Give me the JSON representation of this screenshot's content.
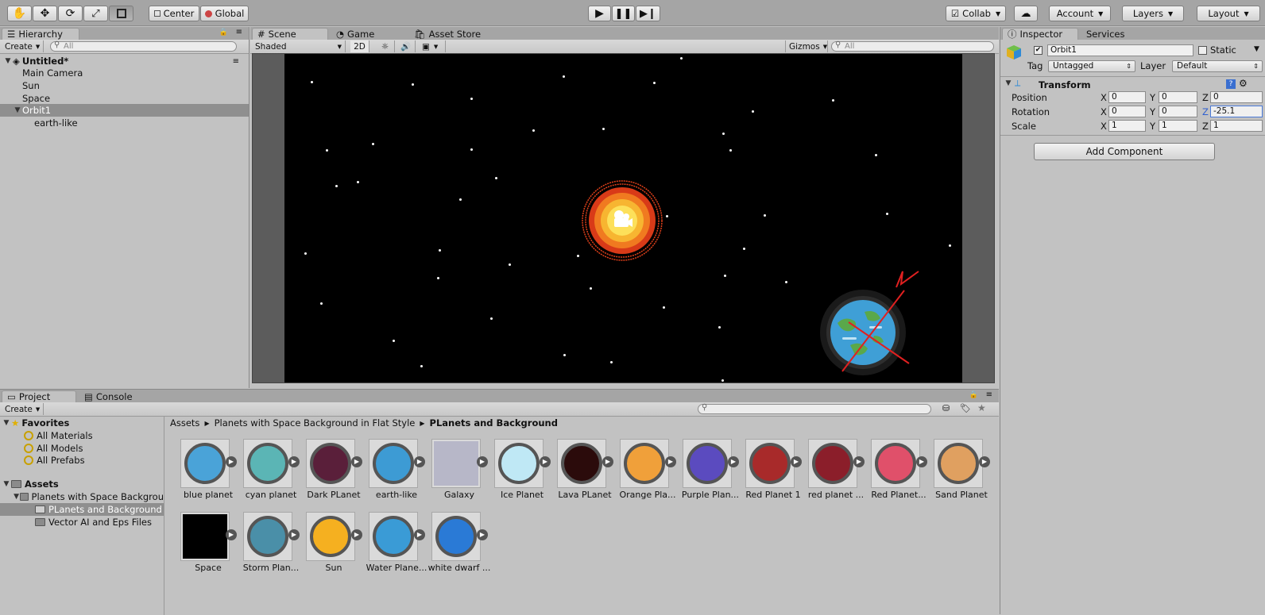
{
  "toolbar": {
    "pivot": "Center",
    "space": "Global",
    "collab": "Collab",
    "account": "Account",
    "layers": "Layers",
    "layout": "Layout"
  },
  "hierarchy": {
    "tab": "Hierarchy",
    "create": "Create",
    "search_placeholder": "All",
    "scene_name": "Untitled*",
    "items": [
      {
        "label": "Main Camera"
      },
      {
        "label": "Sun"
      },
      {
        "label": "Space"
      },
      {
        "label": "Orbit1"
      },
      {
        "label": "earth-like"
      }
    ]
  },
  "scene": {
    "tabs": [
      "Scene",
      "Game",
      "Asset Store"
    ],
    "shading": "Shaded",
    "mode2d": "2D",
    "gizmos": "Gizmos",
    "search_placeholder": "All"
  },
  "inspector": {
    "tabs": [
      "Inspector",
      "Services"
    ],
    "object_name": "Orbit1",
    "static_label": "Static",
    "tag_label": "Tag",
    "tag_value": "Untagged",
    "layer_label": "Layer",
    "layer_value": "Default",
    "component": "Transform",
    "rows": [
      {
        "label": "Position",
        "x": "0",
        "y": "0",
        "z": "0"
      },
      {
        "label": "Rotation",
        "x": "0",
        "y": "0",
        "z": "-25.1"
      },
      {
        "label": "Scale",
        "x": "1",
        "y": "1",
        "z": "1"
      }
    ],
    "axis": {
      "x": "X",
      "y": "Y",
      "z": "Z"
    },
    "add_component": "Add Component"
  },
  "project": {
    "tabs": [
      "Project",
      "Console"
    ],
    "create": "Create",
    "favorites": "Favorites",
    "favorite_items": [
      "All Materials",
      "All Models",
      "All Prefabs"
    ],
    "assets": "Assets",
    "folders": [
      "Planets with Space Backgrou",
      "PLanets and Background",
      "Vector AI and Eps Files"
    ],
    "breadcrumb": [
      "Assets",
      "Planets with Space Background in Flat Style",
      "PLanets and Background"
    ],
    "items": [
      {
        "name": "blue planet",
        "color": "#4aa3d8"
      },
      {
        "name": "cyan planet",
        "color": "#5bb5b5"
      },
      {
        "name": "Dark PLanet",
        "color": "#5a1f3a"
      },
      {
        "name": "earth-like",
        "color": "#3d9bd4"
      },
      {
        "name": "Galaxy",
        "color": "#b7b7c8"
      },
      {
        "name": "Ice Planet",
        "color": "#bfe8f5"
      },
      {
        "name": "Lava PLanet",
        "color": "#2b0b0b"
      },
      {
        "name": "Orange Pla...",
        "color": "#f0a03a"
      },
      {
        "name": "Purple Plan...",
        "color": "#5b4bbf"
      },
      {
        "name": "Red Planet 1",
        "color": "#a82a2a"
      },
      {
        "name": "red planet ...",
        "color": "#8b1e2a"
      },
      {
        "name": "Red Planet...",
        "color": "#e0506a"
      },
      {
        "name": "Sand Planet",
        "color": "#e0a060"
      },
      {
        "name": "Space",
        "color": "#000000"
      },
      {
        "name": "Storm Plan...",
        "color": "#4a8fa8"
      },
      {
        "name": "Sun",
        "color": "#f5b020"
      },
      {
        "name": "Water Plane...",
        "color": "#3a9bd6"
      },
      {
        "name": "white dwarf ...",
        "color": "#2a7ad6"
      }
    ]
  }
}
